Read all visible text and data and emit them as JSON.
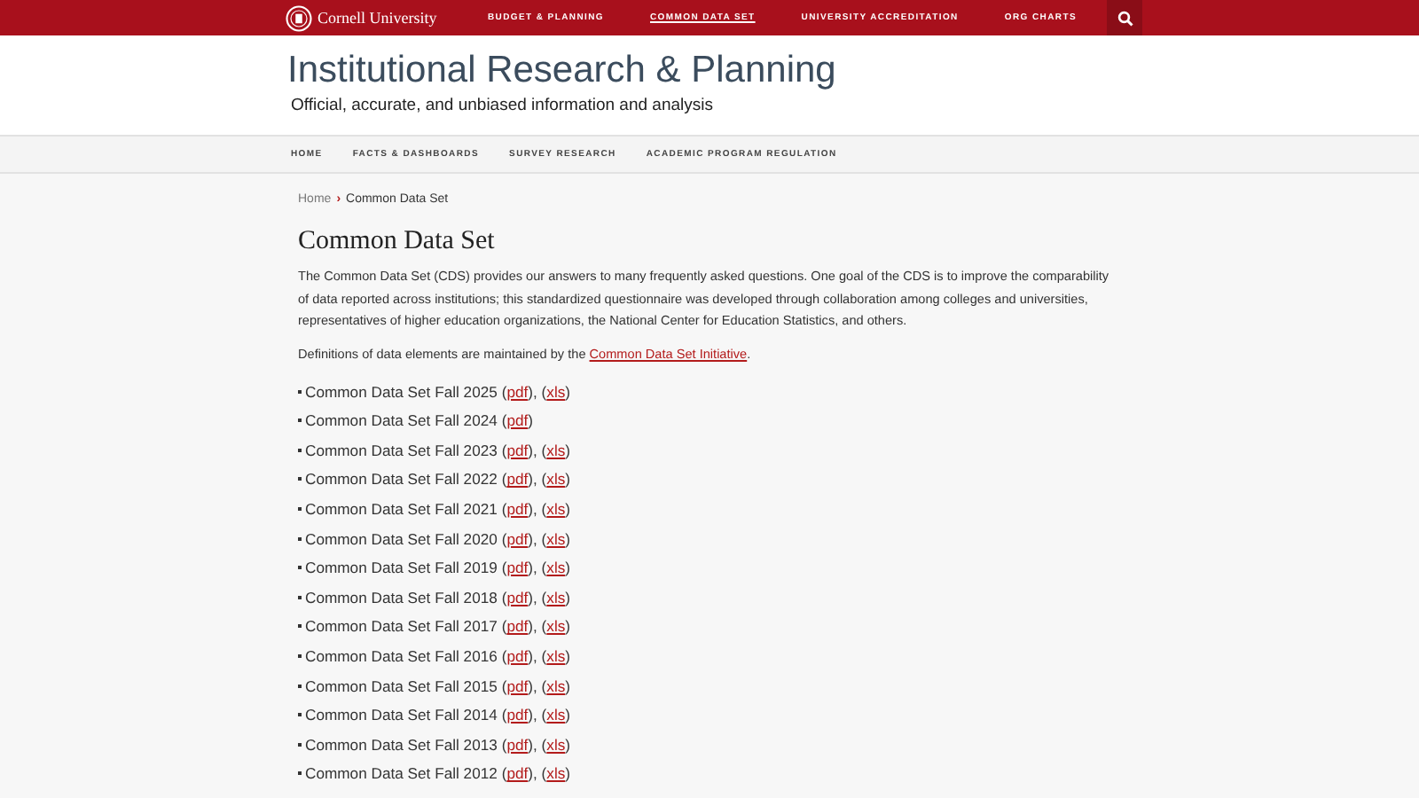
{
  "top_bar": {
    "logo_text": "Cornell University",
    "links": [
      {
        "label": "BUDGET & PLANNING",
        "selected": false
      },
      {
        "label": "COMMON DATA SET",
        "selected": true
      },
      {
        "label": "UNIVERSITY ACCREDITATION",
        "selected": false
      },
      {
        "label": "ORG CHARTS",
        "selected": false
      }
    ]
  },
  "site": {
    "title": "Institutional Research & Planning",
    "tagline": "Official, accurate, and unbiased information and analysis"
  },
  "main_nav": [
    "HOME",
    "FACTS & DASHBOARDS",
    "SURVEY RESEARCH",
    "ACADEMIC PROGRAM REGULATION"
  ],
  "breadcrumb": {
    "home": "Home",
    "separator": "›",
    "current": "Common Data Set"
  },
  "heading": "Common Data Set",
  "intro": "The Common Data Set (CDS) provides our answers to many frequently asked questions.  One goal of the CDS is to improve the comparability of data reported across institutions; this standardized questionnaire was developed through collaboration among colleges and universities, representatives of higher education organizations, the National Center for Education Statistics, and others.",
  "definitions": [
    {
      "kind": "text",
      "text": "Definitions of data elements are maintained by the "
    },
    {
      "kind": "link",
      "text": "Common Data Set Initiative"
    },
    {
      "kind": "text",
      "text": "."
    }
  ],
  "items": [
    [
      {
        "kind": "text",
        "text": "Common Data Set Fall 2025 ("
      },
      {
        "kind": "link",
        "text": "pdf"
      },
      {
        "kind": "text",
        "text": "), ("
      },
      {
        "kind": "link",
        "text": "xls"
      },
      {
        "kind": "text",
        "text": ")"
      }
    ],
    [
      {
        "kind": "text",
        "text": "Common Data Set Fall 2024 ("
      },
      {
        "kind": "link",
        "text": "pdf"
      },
      {
        "kind": "text",
        "text": ")"
      }
    ],
    [
      {
        "kind": "text",
        "text": "Common Data Set Fall 2023 ("
      },
      {
        "kind": "link",
        "text": "pdf"
      },
      {
        "kind": "text",
        "text": "), ("
      },
      {
        "kind": "link",
        "text": "xls"
      },
      {
        "kind": "text",
        "text": ")"
      }
    ],
    [
      {
        "kind": "text",
        "text": "Common Data Set Fall 2022 ("
      },
      {
        "kind": "link",
        "text": "pdf"
      },
      {
        "kind": "text",
        "text": "), ("
      },
      {
        "kind": "link",
        "text": "xls"
      },
      {
        "kind": "text",
        "text": ")"
      }
    ],
    [
      {
        "kind": "text",
        "text": "Common Data Set Fall 2021 ("
      },
      {
        "kind": "link",
        "text": "pdf"
      },
      {
        "kind": "text",
        "text": "), ("
      },
      {
        "kind": "link",
        "text": "xls"
      },
      {
        "kind": "text",
        "text": ")"
      }
    ],
    [
      {
        "kind": "text",
        "text": "Common Data Set Fall 2020 ("
      },
      {
        "kind": "link",
        "text": "pdf"
      },
      {
        "kind": "text",
        "text": "), ("
      },
      {
        "kind": "link",
        "text": "xls"
      },
      {
        "kind": "text",
        "text": ")"
      }
    ],
    [
      {
        "kind": "text",
        "text": "Common Data Set Fall 2019 ("
      },
      {
        "kind": "link",
        "text": "pdf"
      },
      {
        "kind": "text",
        "text": "), ("
      },
      {
        "kind": "link",
        "text": "xls"
      },
      {
        "kind": "text",
        "text": ")"
      }
    ],
    [
      {
        "kind": "text",
        "text": "Common Data Set Fall 2018 ("
      },
      {
        "kind": "link",
        "text": "pdf"
      },
      {
        "kind": "text",
        "text": "), ("
      },
      {
        "kind": "link",
        "text": "xls"
      },
      {
        "kind": "text",
        "text": ")"
      }
    ],
    [
      {
        "kind": "text",
        "text": "Common Data Set Fall 2017 ("
      },
      {
        "kind": "link",
        "text": "pdf"
      },
      {
        "kind": "text",
        "text": "), ("
      },
      {
        "kind": "link",
        "text": "xls"
      },
      {
        "kind": "text",
        "text": ")"
      }
    ],
    [
      {
        "kind": "text",
        "text": "Common Data Set Fall 2016 ("
      },
      {
        "kind": "link",
        "text": "pdf"
      },
      {
        "kind": "text",
        "text": "), ("
      },
      {
        "kind": "link",
        "text": "xls"
      },
      {
        "kind": "text",
        "text": ")"
      }
    ],
    [
      {
        "kind": "text",
        "text": "Common Data Set Fall 2015 ("
      },
      {
        "kind": "link",
        "text": "pdf"
      },
      {
        "kind": "text",
        "text": "), ("
      },
      {
        "kind": "link",
        "text": "xls"
      },
      {
        "kind": "text",
        "text": ")"
      }
    ],
    [
      {
        "kind": "text",
        "text": "Common Data Set Fall 2014 ("
      },
      {
        "kind": "link",
        "text": "pdf"
      },
      {
        "kind": "text",
        "text": "), ("
      },
      {
        "kind": "link",
        "text": "xls"
      },
      {
        "kind": "text",
        "text": ")"
      }
    ],
    [
      {
        "kind": "text",
        "text": "Common Data Set Fall 2013 ("
      },
      {
        "kind": "link",
        "text": "pdf"
      },
      {
        "kind": "text",
        "text": "), ("
      },
      {
        "kind": "link",
        "text": "xls"
      },
      {
        "kind": "text",
        "text": ")"
      }
    ],
    [
      {
        "kind": "text",
        "text": "Common Data Set Fall 2012 ("
      },
      {
        "kind": "link",
        "text": "pdf"
      },
      {
        "kind": "text",
        "text": "), ("
      },
      {
        "kind": "link",
        "text": "xls"
      },
      {
        "kind": "text",
        "text": ")"
      }
    ]
  ]
}
